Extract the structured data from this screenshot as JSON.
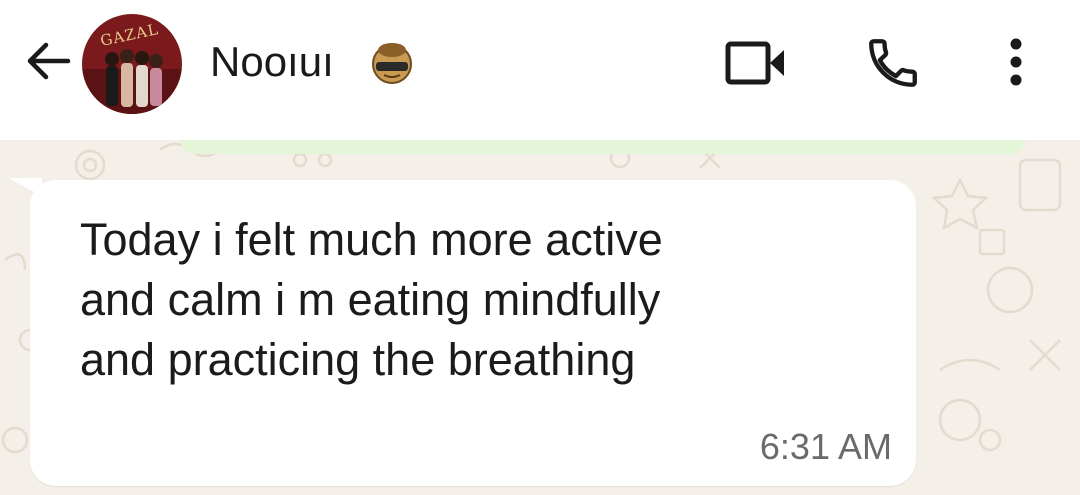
{
  "header": {
    "contact_name": "Nooıuı",
    "avatar_caption": "GAZAL",
    "icons": {
      "back": "arrow-left-icon",
      "sticker": "face-emoji-icon",
      "video": "video-call-icon",
      "voice": "phone-icon",
      "menu": "more-vertical-icon"
    }
  },
  "message": {
    "lines": [
      "Today i felt much more active",
      "and calm i m eating mindfully",
      "and practicing the breathing"
    ],
    "time": "6:31 AM"
  },
  "colors": {
    "header_bg": "#ffffff",
    "wallpaper": "#f4efe8",
    "bubble_bg": "#ffffff",
    "outgoing_hint": "#e5f5d8",
    "text": "#1b1b1b",
    "time_text": "#6a6a6a"
  }
}
